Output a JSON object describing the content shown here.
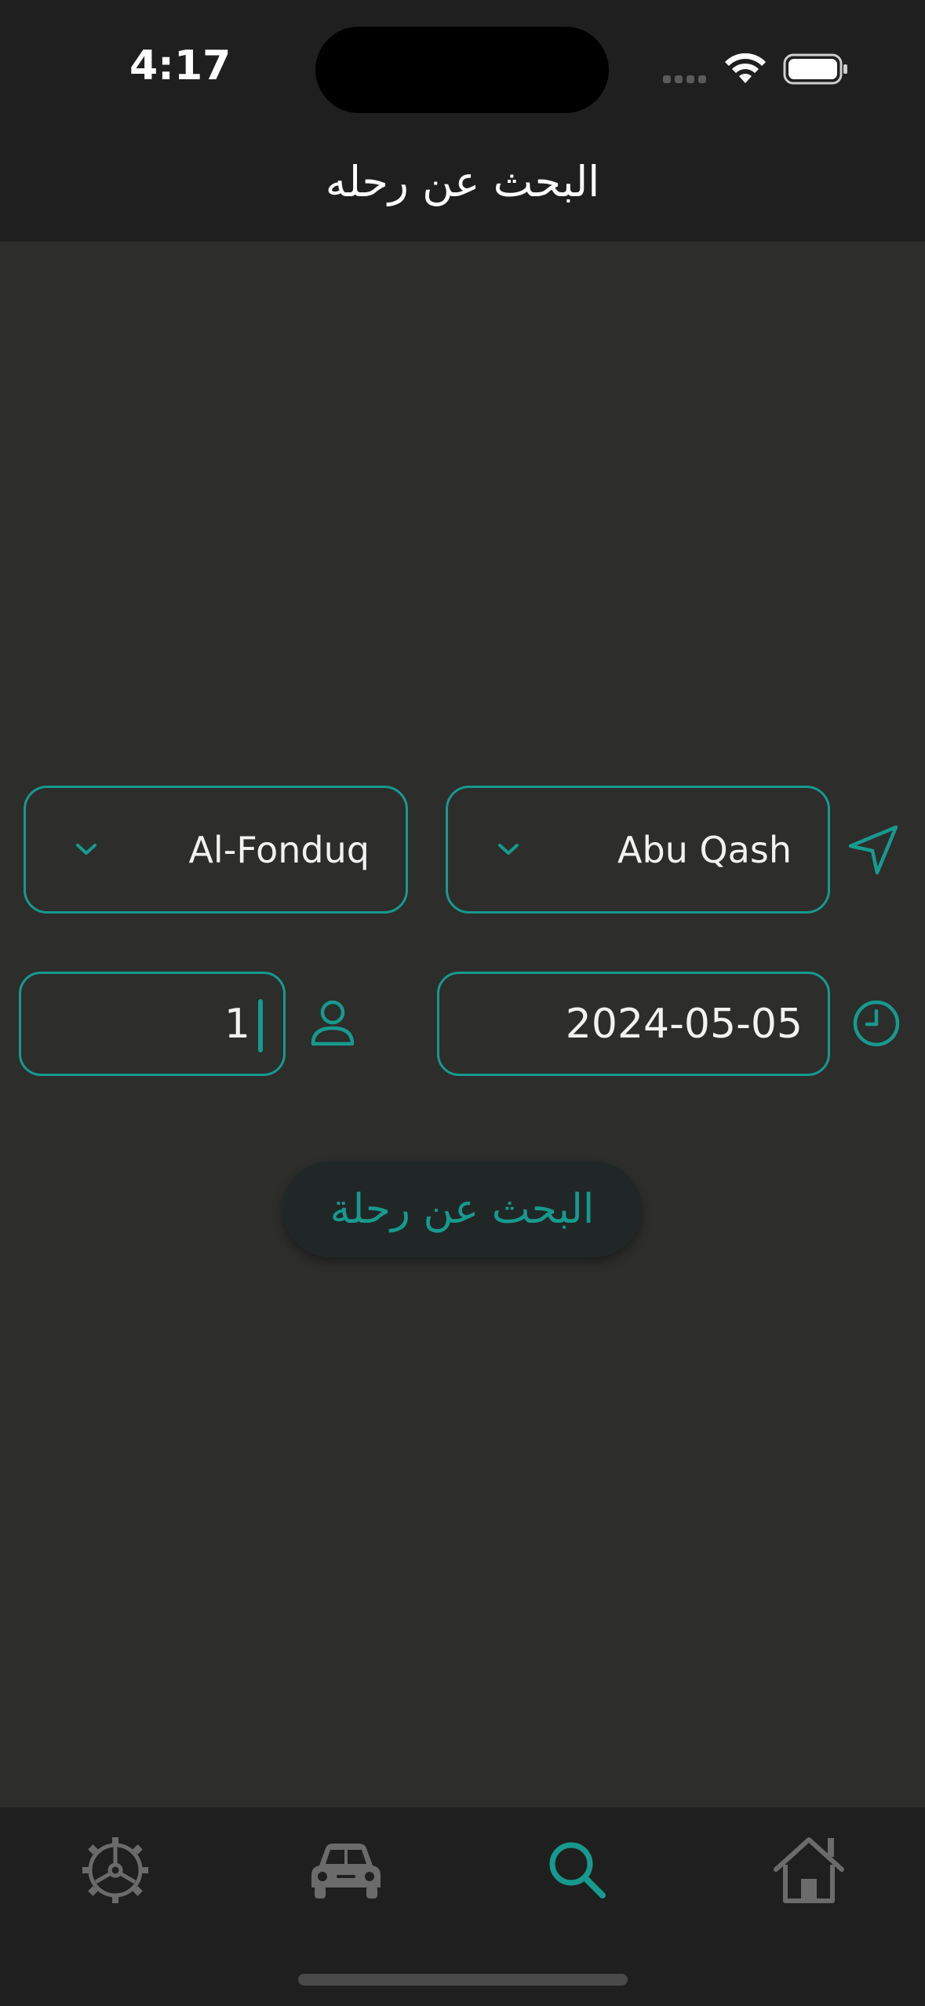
{
  "status_bar": {
    "time": "4:17"
  },
  "header": {
    "title": "البحث عن رحله"
  },
  "form": {
    "to_city": "Al-Fonduq",
    "from_city": "Abu Qash",
    "passengers": "1",
    "date": "2024-05-05",
    "search_button_label": "البحث عن رحلة"
  },
  "tab_bar": {
    "items": [
      "settings-icon",
      "car-icon",
      "search-icon",
      "home-icon"
    ],
    "active": "search-icon"
  },
  "colors": {
    "accent": "#169a8e",
    "background": "#2d2d2c",
    "bars": "#1f1f1f",
    "inactive_icon": "#6b6b6b"
  }
}
